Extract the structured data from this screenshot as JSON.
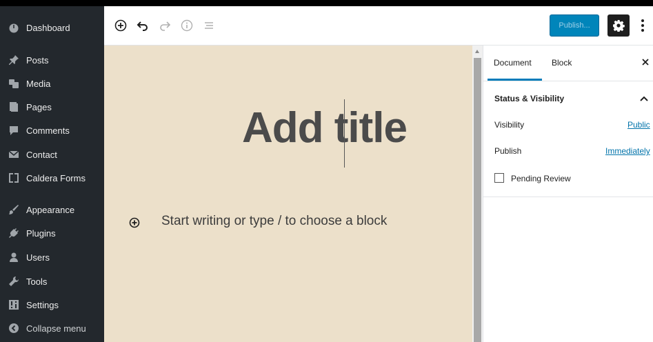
{
  "sidebar": {
    "items": [
      {
        "label": "Dashboard",
        "icon": "dashboard-icon"
      },
      {
        "label": "Posts",
        "icon": "pin-icon"
      },
      {
        "label": "Media",
        "icon": "media-icon"
      },
      {
        "label": "Pages",
        "icon": "pages-icon"
      },
      {
        "label": "Comments",
        "icon": "comment-icon"
      },
      {
        "label": "Contact",
        "icon": "mail-icon"
      },
      {
        "label": "Caldera Forms",
        "icon": "forms-icon"
      },
      {
        "label": "Appearance",
        "icon": "brush-icon"
      },
      {
        "label": "Plugins",
        "icon": "plugin-icon"
      },
      {
        "label": "Users",
        "icon": "user-icon"
      },
      {
        "label": "Tools",
        "icon": "wrench-icon"
      },
      {
        "label": "Settings",
        "icon": "settings-grid-icon"
      },
      {
        "label": "Collapse menu",
        "icon": "collapse-icon"
      }
    ]
  },
  "toolbar": {
    "publish_label": "Publish...",
    "icons": [
      "add-block-icon",
      "undo-icon",
      "redo-icon",
      "info-icon",
      "outline-icon",
      "gear-icon",
      "more-vertical-icon"
    ]
  },
  "editor": {
    "title_placeholder": "Add title",
    "block_prompt": "Start writing or type / to choose a block",
    "canvas_color": "#ece0ca"
  },
  "panel": {
    "tabs": [
      {
        "label": "Document"
      },
      {
        "label": "Block"
      }
    ],
    "active_tab": "Document",
    "section_title": "Status & Visibility",
    "visibility_label": "Visibility",
    "visibility_value": "Public",
    "publish_label": "Publish",
    "publish_value": "Immediately",
    "pending_review_label": "Pending Review",
    "pending_review_checked": false
  },
  "colors": {
    "sidebar_bg": "#23282d",
    "accent": "#007cba",
    "publish_button": "#0085ba"
  }
}
